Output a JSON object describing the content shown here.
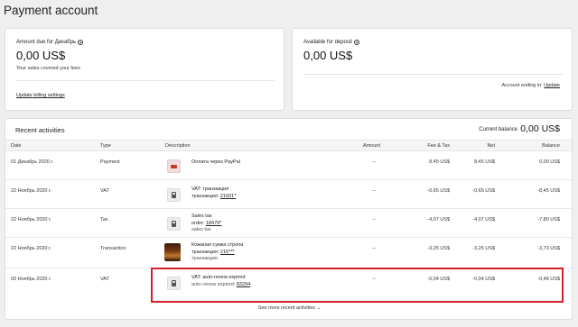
{
  "page": {
    "title": "Payment account"
  },
  "due": {
    "label": "Amount due for Декабрь",
    "amount": "0,00 US$",
    "sub": "Your sales covered your fees",
    "link": "Update billing settings"
  },
  "available": {
    "label": "Available for deposit",
    "amount": "0,00 US$",
    "footnote": "Account ending in:",
    "link": "Update"
  },
  "activities": {
    "title": "Recent activities",
    "balance_label": "Current balance",
    "balance_value": "0,00 US$",
    "headers": {
      "date": "Date",
      "type": "Type",
      "description": "Description",
      "amount": "Amount",
      "fee": "Fee & Tax",
      "net": "Net",
      "balance": "Balance"
    },
    "rows": [
      {
        "date": "01 Декабрь 2020 г.",
        "type": "Payment",
        "icon": "paypal-icon",
        "line1": "Оплата через PayPal",
        "line2": "",
        "line3": "",
        "amount": "--",
        "fee": "8,45 US$",
        "net": "8,45 US$",
        "balance": "0,00 US$"
      },
      {
        "date": "22 Ноябрь 2020 г.",
        "type": "VAT",
        "icon": "calculator-icon",
        "line1": "VAT: транзакция",
        "line2_prefix": "транзакция: ",
        "line2_link": "21601*",
        "line3": "",
        "amount": "--",
        "fee": "-0,65 US$",
        "net": "-0,65 US$",
        "balance": "-8,45 US$"
      },
      {
        "date": "22 Ноябрь 2020 г.",
        "type": "Tax",
        "icon": "calculator-icon",
        "line1": "Sales tax",
        "line2_prefix": "order: ",
        "line2_link": "18479*",
        "line3": "sales tax",
        "amount": "--",
        "fee": "-4,07 US$",
        "net": "-4,07 US$",
        "balance": "-7,80 US$"
      },
      {
        "date": "22 Ноябрь 2020 г.",
        "type": "Transaction",
        "icon": "bag-product-thumbnail",
        "line1": "Кожаная сумка стропа",
        "line2_prefix": "транзакция: ",
        "line2_link": "216***",
        "line3": "транзакция",
        "amount": "--",
        "fee": "-3,25 US$",
        "net": "-3,25 US$",
        "balance": "-3,73 US$"
      },
      {
        "date": "03 Ноябрь 2020 г.",
        "type": "VAT",
        "icon": "calculator-icon",
        "line1": "VAT: auto-renew expired",
        "line2_prefix": "auto renew expired: ",
        "line2_link": "83294",
        "line3": "",
        "amount": "--",
        "fee": "-0,04 US$",
        "net": "-0,04 US$",
        "balance": "-0,48 US$"
      }
    ],
    "see_more": "See more recent activities ⌄"
  },
  "colors": {
    "highlight": "#d32027",
    "background": "#efefef"
  }
}
